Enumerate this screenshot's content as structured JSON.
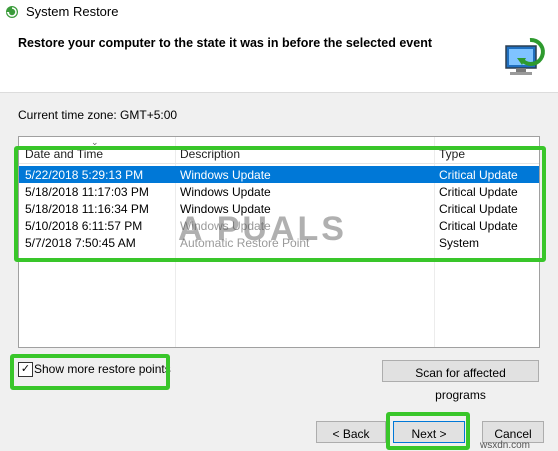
{
  "window": {
    "title": "System Restore"
  },
  "header": {
    "heading": "Restore your computer to the state it was in before the selected event"
  },
  "timezone": {
    "label": "Current time zone: GMT+5:00"
  },
  "table": {
    "columns": [
      "Date and Time",
      "Description",
      "Type"
    ],
    "rows": [
      {
        "date": "5/22/2018 5:29:13 PM",
        "description": "Windows Update",
        "type": "Critical Update",
        "selected": true
      },
      {
        "date": "5/18/2018 11:17:03 PM",
        "description": "Windows Update",
        "type": "Critical Update"
      },
      {
        "date": "5/18/2018 11:16:34 PM",
        "description": "Windows Update",
        "type": "Critical Update"
      },
      {
        "date": "5/10/2018 6:11:57 PM",
        "description": "Windows Update",
        "type": "Critical Update"
      },
      {
        "date": "5/7/2018 7:50:45 AM",
        "description": "Automatic Restore Point",
        "type": "System"
      }
    ]
  },
  "options": {
    "show_more_label": "Show more restore points",
    "show_more_checked": true
  },
  "buttons": {
    "scan": "Scan for affected programs",
    "back": "< Back",
    "next": "Next >",
    "cancel": "Cancel"
  },
  "watermark": {
    "text": "A PUALS",
    "site": "wsxdn.com"
  },
  "colors": {
    "selection": "#0078d7",
    "highlight": "#39c62a"
  }
}
